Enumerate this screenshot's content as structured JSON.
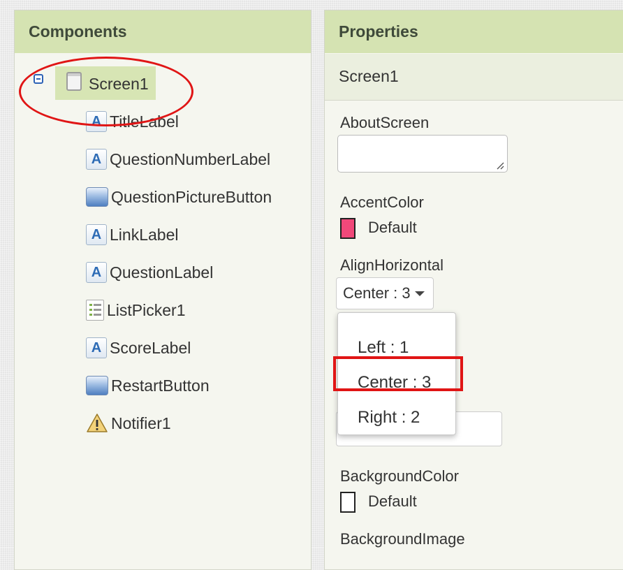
{
  "components": {
    "header": "Components",
    "root": "Screen1",
    "items": [
      {
        "label": "TitleLabel",
        "icon": "label-icon"
      },
      {
        "label": "QuestionNumberLabel",
        "icon": "label-icon"
      },
      {
        "label": "QuestionPictureButton",
        "icon": "button-icon"
      },
      {
        "label": "LinkLabel",
        "icon": "label-icon"
      },
      {
        "label": "QuestionLabel",
        "icon": "label-icon"
      },
      {
        "label": "ListPicker1",
        "icon": "listpicker-icon"
      },
      {
        "label": "ScoreLabel",
        "icon": "label-icon"
      },
      {
        "label": "RestartButton",
        "icon": "button-icon"
      },
      {
        "label": "Notifier1",
        "icon": "warning-icon"
      }
    ]
  },
  "properties": {
    "header": "Properties",
    "selected": "Screen1",
    "about_screen": {
      "label": "AboutScreen",
      "value": ""
    },
    "accent_color": {
      "label": "AccentColor",
      "value": "Default",
      "color": "#f1487a"
    },
    "align_horizontal": {
      "label": "AlignHorizontal",
      "value": "Center : 3",
      "options": [
        "Left : 1",
        "Center : 3",
        "Right : 2"
      ]
    },
    "background_color": {
      "label": "BackgroundColor",
      "value": "Default",
      "color": "#ffffff"
    },
    "background_image": {
      "label": "BackgroundImage"
    }
  },
  "colors": {
    "header_bg": "#d5e3b2",
    "annotation_red": "#e01515"
  }
}
